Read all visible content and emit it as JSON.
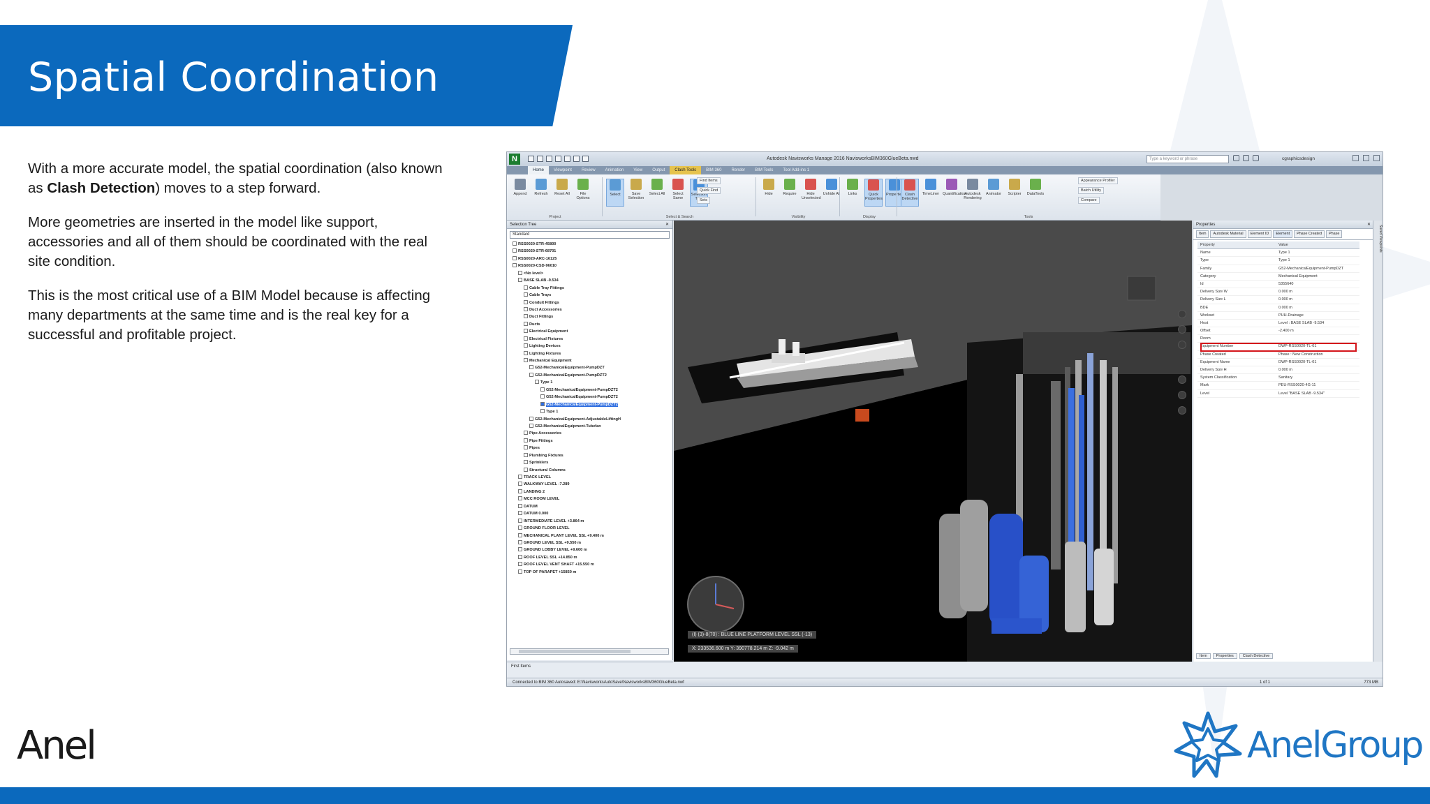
{
  "slide": {
    "title": "Spatial Coordination",
    "paragraphs": [
      {
        "pre": "With a more accurate model, the spatial coordination (also known as ",
        "bold": "Clash Detection",
        "post": ") moves to a step forward."
      },
      {
        "text": "More geometries are inserted in the model like support, accessories and all of them should be coordinated with the real site condition."
      },
      {
        "text": "This is the most critical use of a BIM Model because is affecting many departments at the same time and is the real key for a successful and profitable project."
      }
    ],
    "logo_left": "Anel",
    "logo_right": "AnelGroup",
    "colors": {
      "brand_blue": "#0b69bd",
      "highlight_red": "#d4151b"
    }
  },
  "app": {
    "logo": "N",
    "title": "Autodesk Navisworks Manage 2016   NavisworksBIM360GlueBeta.nwd",
    "search_placeholder": "Type a keyword or phrase",
    "user": "cgraphicsdesign",
    "tabs": [
      "Home",
      "Viewpoint",
      "Review",
      "Animation",
      "View",
      "Output",
      "Clash Tools",
      "BIM 360",
      "Render",
      "BIM Tools",
      "Tool Add-ins 1"
    ],
    "active_tab": "Home",
    "ribbon_groups": [
      {
        "label": "Project",
        "buttons": [
          "Append",
          "Refresh",
          "Reset All",
          "File Options"
        ]
      },
      {
        "label": "Select & Search",
        "buttons": [
          "Select",
          "Save Selection",
          "Select All",
          "Select Same",
          "Selection Tree"
        ]
      },
      {
        "label": "Visibility",
        "buttons": [
          "Hide",
          "Require",
          "Hide Unselected",
          "Unhide All"
        ]
      },
      {
        "label": "Display",
        "buttons": [
          "Links",
          "Quick Properties",
          "Properties"
        ]
      },
      {
        "label": "Tools",
        "buttons": [
          "Clash Detective",
          "TimeLiner",
          "Quantification",
          "Autodesk Rendering",
          "Animator",
          "Scripter",
          "DataTools"
        ]
      }
    ],
    "ribbon_extras": [
      "Find Items",
      "Quick Find",
      "Sets",
      "Appearance Profiler",
      "Batch Utility",
      "Compare"
    ]
  },
  "selection_tree": {
    "title": "Selection Tree",
    "dropdown": "Standard",
    "items": [
      {
        "label": "RSS0020-STR-45800",
        "level": 0
      },
      {
        "label": "RSS0020-STR-68701",
        "level": 0
      },
      {
        "label": "RSS0020-ARC-16125",
        "level": 0
      },
      {
        "label": "RSS0020-CSD-96010",
        "level": 0
      },
      {
        "label": "<No level>",
        "level": 1
      },
      {
        "label": "BASE SLAB -9.534",
        "level": 1
      },
      {
        "label": "Cable Tray Fittings",
        "level": 2
      },
      {
        "label": "Cable Trays",
        "level": 2
      },
      {
        "label": "Conduit Fittings",
        "level": 2
      },
      {
        "label": "Duct Accessories",
        "level": 2
      },
      {
        "label": "Duct Fittings",
        "level": 2
      },
      {
        "label": "Ducts",
        "level": 2
      },
      {
        "label": "Electrical Equipment",
        "level": 2
      },
      {
        "label": "Electrical Fixtures",
        "level": 2
      },
      {
        "label": "Lighting Devices",
        "level": 2
      },
      {
        "label": "Lighting Fixtures",
        "level": 2
      },
      {
        "label": "Mechanical Equipment",
        "level": 2
      },
      {
        "label": "G52-MechanicalEquipment-PumpDZT",
        "level": 3
      },
      {
        "label": "G52-MechanicalEquipment-PumpDZT2",
        "level": 3
      },
      {
        "label": "Type 1",
        "level": 4
      },
      {
        "label": "G52-MechanicalEquipment-PumpDZT2",
        "level": 5
      },
      {
        "label": "G52-MechanicalEquipment-PumpDZT2",
        "level": 5
      },
      {
        "label": "G52-MechanicalEquipment-PumpDZT2",
        "level": 5,
        "selected": true
      },
      {
        "label": "Type 1",
        "level": 5
      },
      {
        "label": "G52-MechanicalEquipment-AdjustableLiftingH",
        "level": 3
      },
      {
        "label": "G52-MechanicalEquipment-Tubefan",
        "level": 3
      },
      {
        "label": "Pipe Accessories",
        "level": 2
      },
      {
        "label": "Pipe Fittings",
        "level": 2
      },
      {
        "label": "Pipes",
        "level": 2
      },
      {
        "label": "Plumbing Fixtures",
        "level": 2
      },
      {
        "label": "Sprinklers",
        "level": 2
      },
      {
        "label": "Structural Columns",
        "level": 2
      },
      {
        "label": "TRACK LEVEL",
        "level": 1
      },
      {
        "label": "WALKWAY LEVEL -7.289",
        "level": 1
      },
      {
        "label": "LANDING 2",
        "level": 1
      },
      {
        "label": "MCC ROOM LEVEL",
        "level": 1
      },
      {
        "label": "DATUM",
        "level": 1
      },
      {
        "label": "DATUM 0.000",
        "level": 1
      },
      {
        "label": "INTERMEDIATE LEVEL +3.864 m",
        "level": 1
      },
      {
        "label": "GROUND FLOOR LEVEL",
        "level": 1
      },
      {
        "label": "MECHANICAL PLANT LEVEL SSL +9.400 m",
        "level": 1
      },
      {
        "label": "GROUND LEVEL SSL +9.550 m",
        "level": 1
      },
      {
        "label": "GROUND LOBBY LEVEL +9.600 m",
        "level": 1
      },
      {
        "label": "ROOF LEVEL SSL +14.850 m",
        "level": 1
      },
      {
        "label": "ROOF LEVEL VENT SHAFT +15.550 m",
        "level": 1
      },
      {
        "label": "TOP OF PARAPET +15850 m",
        "level": 1
      }
    ],
    "footer": "First Items"
  },
  "viewport": {
    "level_label": "(I) (3)-8(70) : BLUE LINE PLATFORM LEVEL SSL (-13)",
    "coords": "X: 233536.600 m  Y: 390778.214 m  Z: -9.042 m"
  },
  "properties": {
    "title": "Properties",
    "tabs": [
      "Item",
      "Autodesk Material",
      "Element ID",
      "Element",
      "Phase Created",
      "Phase"
    ],
    "headers": [
      "Property",
      "Value"
    ],
    "rows": [
      [
        "Name",
        "Type 1"
      ],
      [
        "Type",
        "Type 1"
      ],
      [
        "Family",
        "G52-MechanicalEquipment-PumpDZT"
      ],
      [
        "Category",
        "Mechanical Equipment"
      ],
      [
        "Id",
        "5355640"
      ],
      [
        "Delivery Size W",
        "0.000 m"
      ],
      [
        "Delivery Size L",
        "0.000 m"
      ],
      [
        "BDE",
        "0.000 m"
      ],
      [
        "Workset",
        "PUH-Drainage"
      ],
      [
        "Host",
        "Level : BASE SLAB -9.534"
      ],
      [
        "Offset",
        "-2.400 m"
      ],
      [
        "Room",
        ""
      ],
      [
        "Equipment Number",
        "DWP-RSS0020-TL-01"
      ],
      [
        "Phase Created",
        "Phase : New Construction"
      ],
      [
        "Equipment Name",
        "DWP-RSS0020-TL-01"
      ],
      [
        "Delivery Size H",
        "0.000 m"
      ],
      [
        "System Classification",
        "Sanitary"
      ],
      [
        "Mark",
        "PEU-RSS0020-4G-11"
      ],
      [
        "Level",
        "Level \"BASE SLAB -9.534\""
      ]
    ],
    "highlighted_row": "Equipment Number",
    "footer_tabs": [
      "Item",
      "Properties",
      "Clash Detective"
    ],
    "side_tab": "Saved Viewpoints"
  },
  "status_bar": {
    "text": "Connected to BIM 360    Autosaved: E:\\NavisworksAutoSave\\NavisworksBIM360GlueBeta.nwf",
    "page": "1 of 1",
    "memory": "773 MB"
  }
}
